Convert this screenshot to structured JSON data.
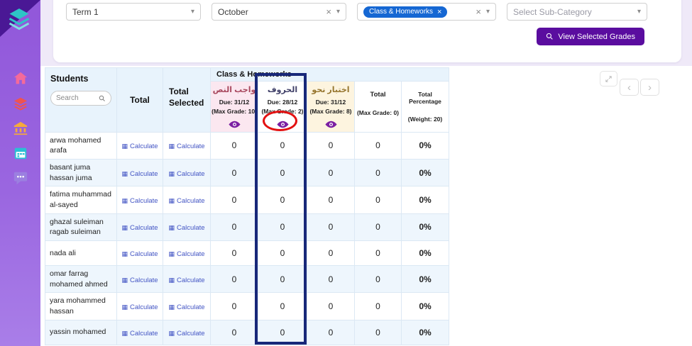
{
  "sidebar": {
    "icons": [
      "logo",
      "school",
      "subjects",
      "bank",
      "calendar",
      "chat"
    ]
  },
  "filters": {
    "term": "Term 1",
    "month": "October",
    "category_chip": "Class & Homeworks",
    "subcategory_placeholder": "Select Sub-Category",
    "view_grades_button": "View Selected Grades"
  },
  "icons": {
    "caret": "▾",
    "clear": "×",
    "calc": "▦",
    "prev": "‹",
    "next": "›"
  },
  "table": {
    "students_header": "Students",
    "search_placeholder": "Search",
    "total_header": "Total",
    "total_selected_header": "Total Selected",
    "group_header": "Class & Homeworks",
    "calculate_label": "Calculate",
    "columns": [
      {
        "title": "واجب النص",
        "due": "Due: 31/12",
        "max": "(Max Grade: 10)"
      },
      {
        "title": "الحروف",
        "due": "Due: 28/12",
        "max": "(Max Grade: 2)"
      },
      {
        "title": "اختبار نحو",
        "due": "Due: 31/12",
        "max": "(Max Grade: 8)"
      },
      {
        "title": "Total",
        "max": "(Max Grade: 0)"
      },
      {
        "title": "Total Percentage",
        "max": "(Weight: 20)"
      }
    ],
    "rows": [
      {
        "student": "arwa mohamed arafa",
        "values": [
          "0",
          "0",
          "0",
          "0",
          "0%"
        ]
      },
      {
        "student": "basant juma hassan juma",
        "values": [
          "0",
          "0",
          "0",
          "0",
          "0%"
        ]
      },
      {
        "student": "fatima muhammad al-sayed",
        "values": [
          "0",
          "0",
          "0",
          "0",
          "0%"
        ]
      },
      {
        "student": "ghazal suleiman ragab suleiman",
        "values": [
          "0",
          "0",
          "0",
          "0",
          "0%"
        ]
      },
      {
        "student": "nada ali",
        "values": [
          "0",
          "0",
          "0",
          "0",
          "0%"
        ]
      },
      {
        "student": "omar farrag mohamed ahmed",
        "values": [
          "0",
          "0",
          "0",
          "0",
          "0%"
        ]
      },
      {
        "student": "yara mohammed hassan",
        "values": [
          "0",
          "0",
          "0",
          "0",
          "0%"
        ]
      },
      {
        "student": "yassin mohamed",
        "values": [
          "0",
          "0",
          "0",
          "0",
          "0%"
        ]
      }
    ]
  },
  "annotations": {
    "highlighted_column": "الحروف",
    "circled_element": "eye-icon"
  },
  "colors": {
    "accent_purple": "#5a0d9f",
    "chip_blue": "#1567d3",
    "calculate_link": "#4355c4",
    "eye_purple": "#7b1fa2",
    "header_blue": "#e8f3fc",
    "column_pink": "#fbe7f0",
    "column_cream": "#fdf4df",
    "annotation_navy": "#182879",
    "annotation_red": "#e31111"
  }
}
